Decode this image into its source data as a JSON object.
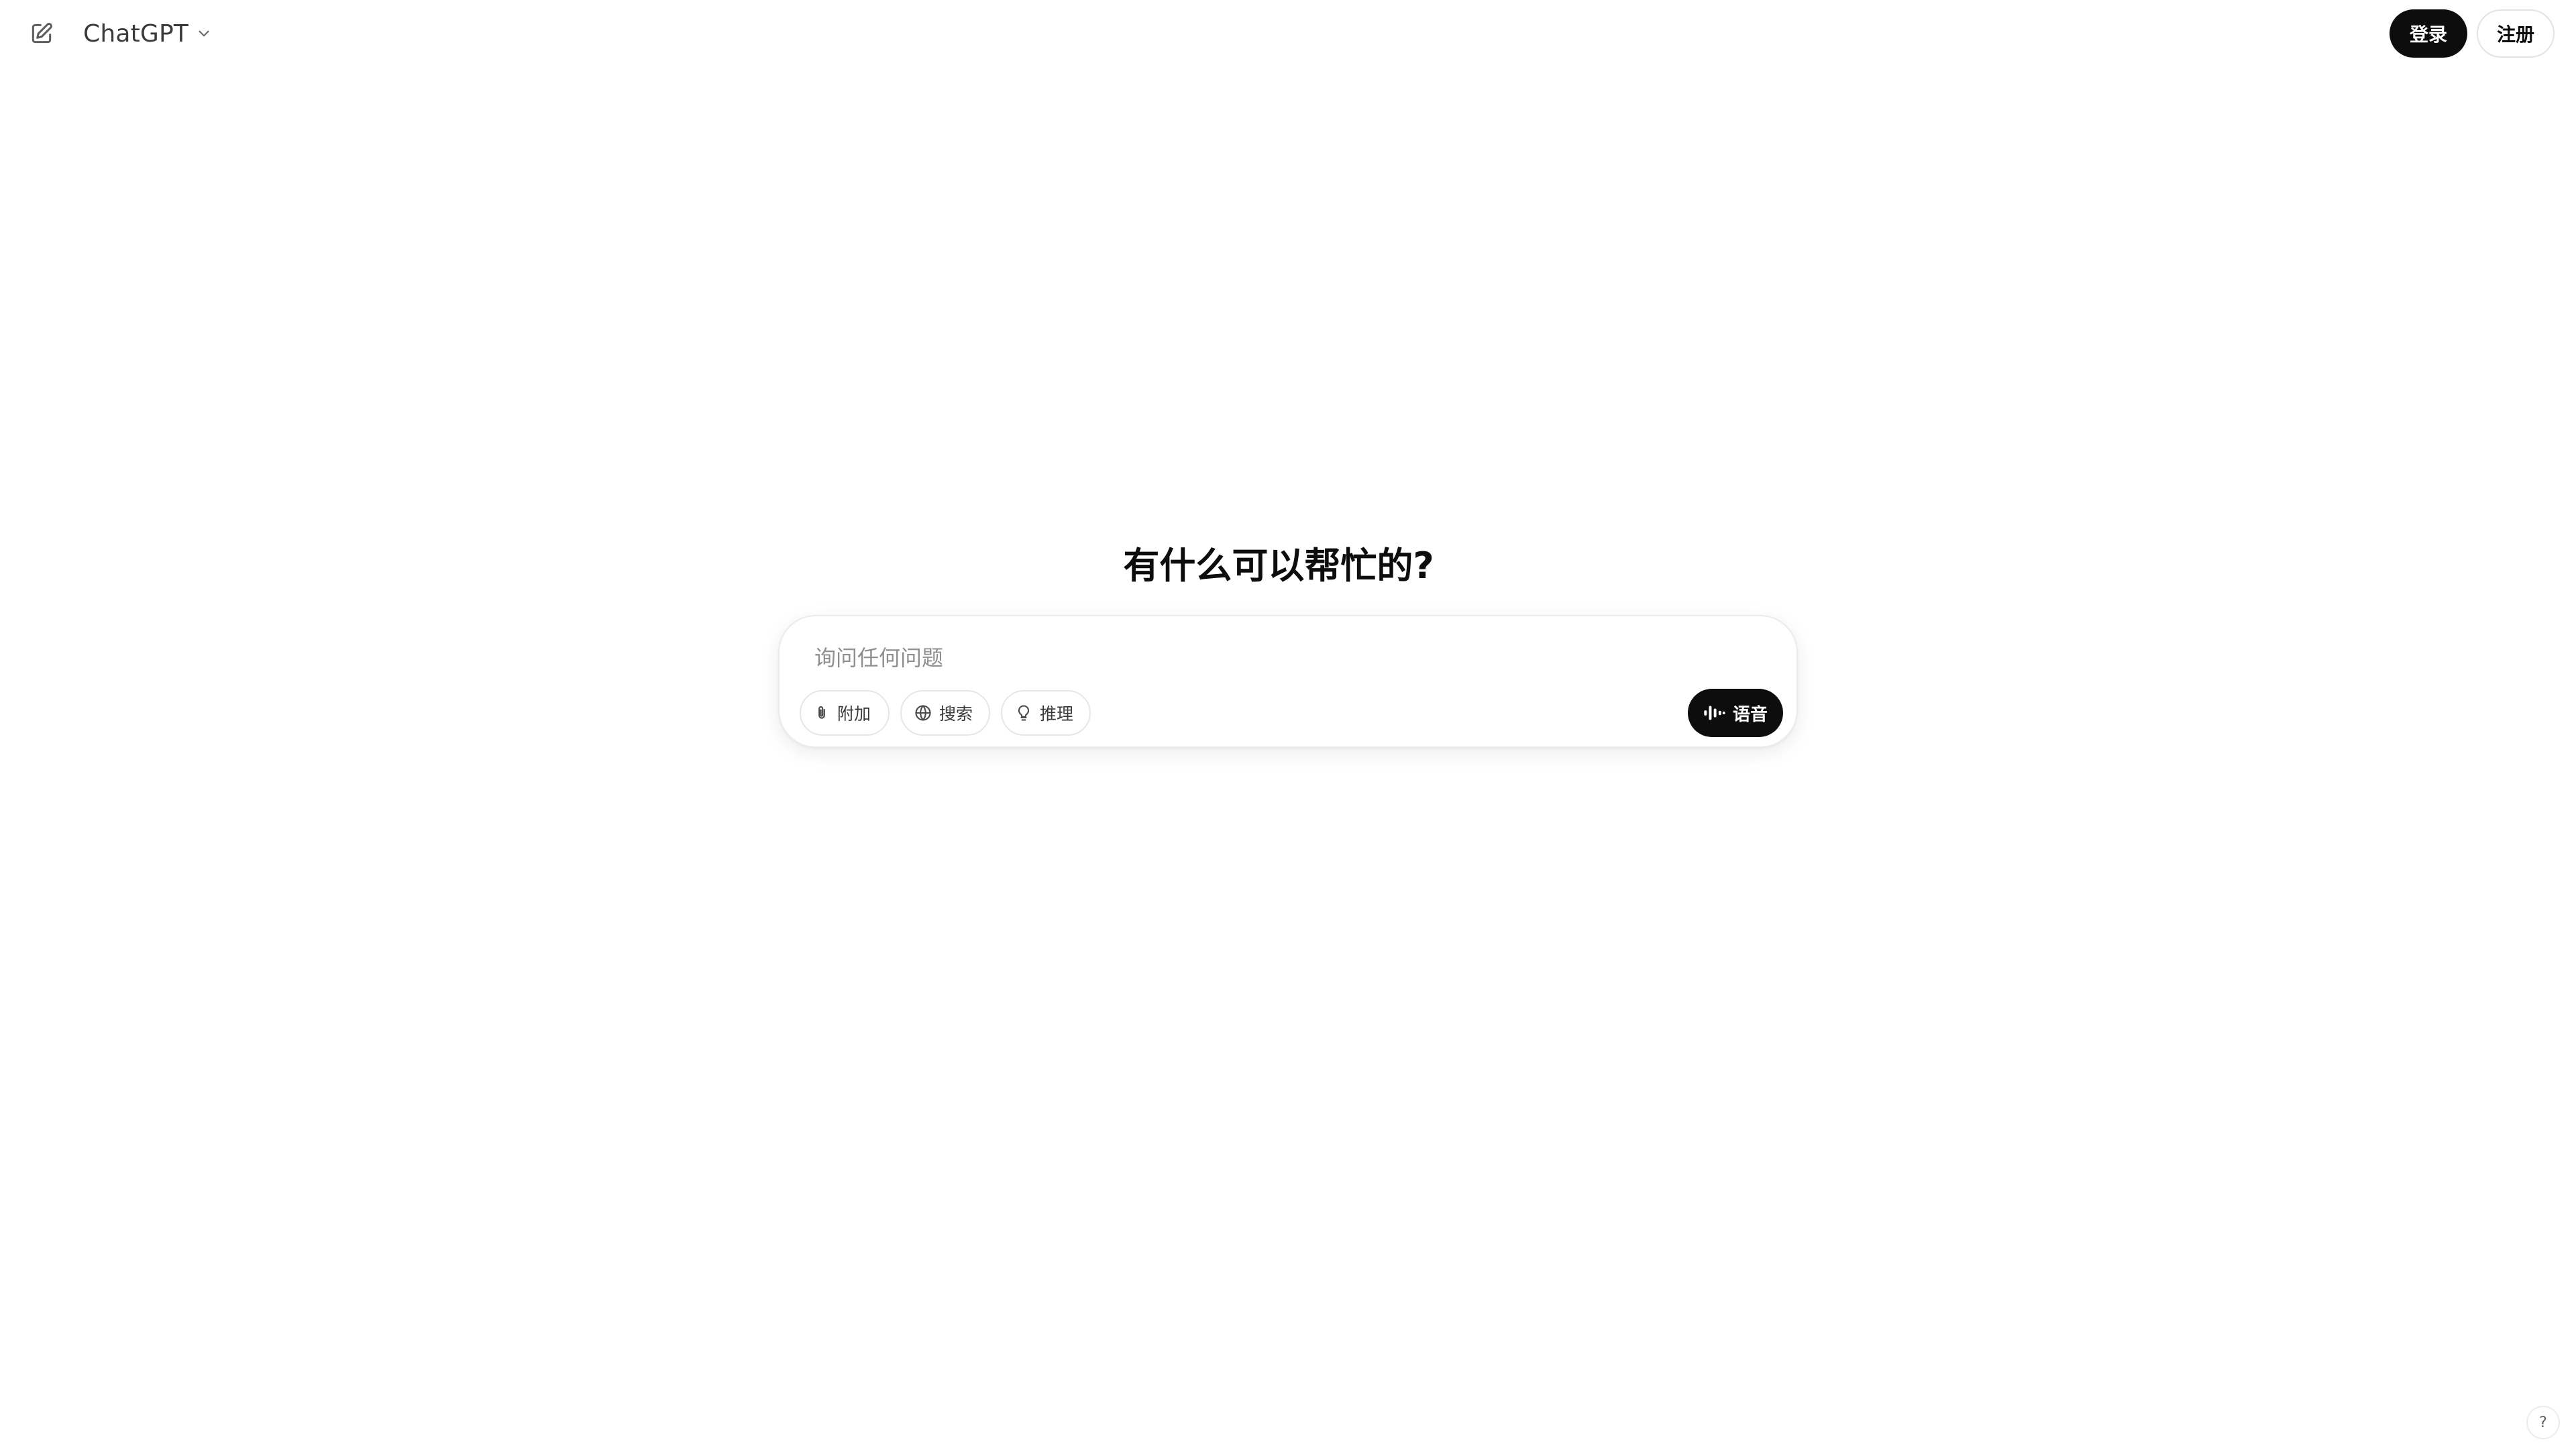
{
  "header": {
    "new_chat_icon": "edit-square-icon",
    "model_name": "ChatGPT",
    "model_chevron_icon": "chevron-down-icon",
    "login_label": "登录",
    "signup_label": "注册"
  },
  "main": {
    "headline": "有什么可以帮忙的?",
    "composer": {
      "placeholder": "询问任何问题",
      "value": "",
      "tools": [
        {
          "label": "附加",
          "icon": "paperclip-icon"
        },
        {
          "label": "搜索",
          "icon": "globe-icon"
        },
        {
          "label": "推理",
          "icon": "lightbulb-icon"
        }
      ],
      "voice_label": "语音",
      "voice_icon": "waveform-icon"
    }
  },
  "footer": {
    "help_label": "?"
  },
  "colors": {
    "primary_button": "#0d0d0d",
    "background": "#ffffff",
    "border": "#e6e6e6",
    "placeholder": "#8f8f8f"
  }
}
